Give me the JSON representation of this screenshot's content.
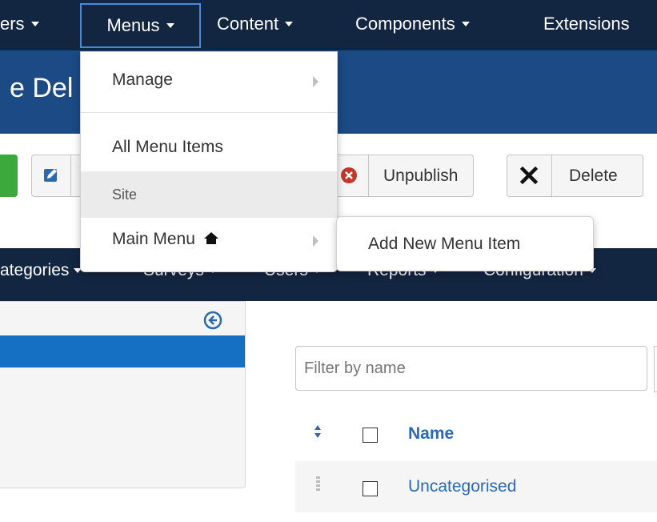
{
  "topnav": {
    "items": [
      {
        "label": "ers",
        "name": "top-menu-users"
      },
      {
        "label": "Menus",
        "name": "top-menu-menus"
      },
      {
        "label": "Content",
        "name": "top-menu-content"
      },
      {
        "label": "Components",
        "name": "top-menu-components"
      },
      {
        "label": "Extensions",
        "name": "top-menu-extensions"
      }
    ]
  },
  "page": {
    "title": "e Del"
  },
  "toolbar": {
    "unpublish_label": "Unpublish",
    "delete_label": "Delete"
  },
  "subnav": {
    "items": [
      {
        "label": "ategories"
      },
      {
        "label": "Surveys"
      },
      {
        "label": "Users"
      },
      {
        "label": "Reports"
      },
      {
        "label": "Configuration"
      }
    ]
  },
  "filter": {
    "placeholder": "Filter by name"
  },
  "table": {
    "header_name": "Name",
    "rows": [
      {
        "name": "Uncategorised"
      }
    ]
  },
  "menus_dropdown": {
    "manage": "Manage",
    "all_menu_items": "All Menu Items",
    "site_header": "Site",
    "main_menu": "Main Menu"
  },
  "submenu": {
    "add_new": "Add New Menu Item"
  },
  "colors": {
    "topbar": "#132641",
    "titlebar": "#1b4a84",
    "accent": "#2a6ab0",
    "active": "#1570c4",
    "unpublish_red": "#c0392b"
  },
  "icons": [
    "edit-icon",
    "unpublish-x-icon",
    "delete-x-icon",
    "collapse-left-icon",
    "sort-icon",
    "home-icon",
    "drag-handle-icon",
    "chevron-right-icon"
  ]
}
